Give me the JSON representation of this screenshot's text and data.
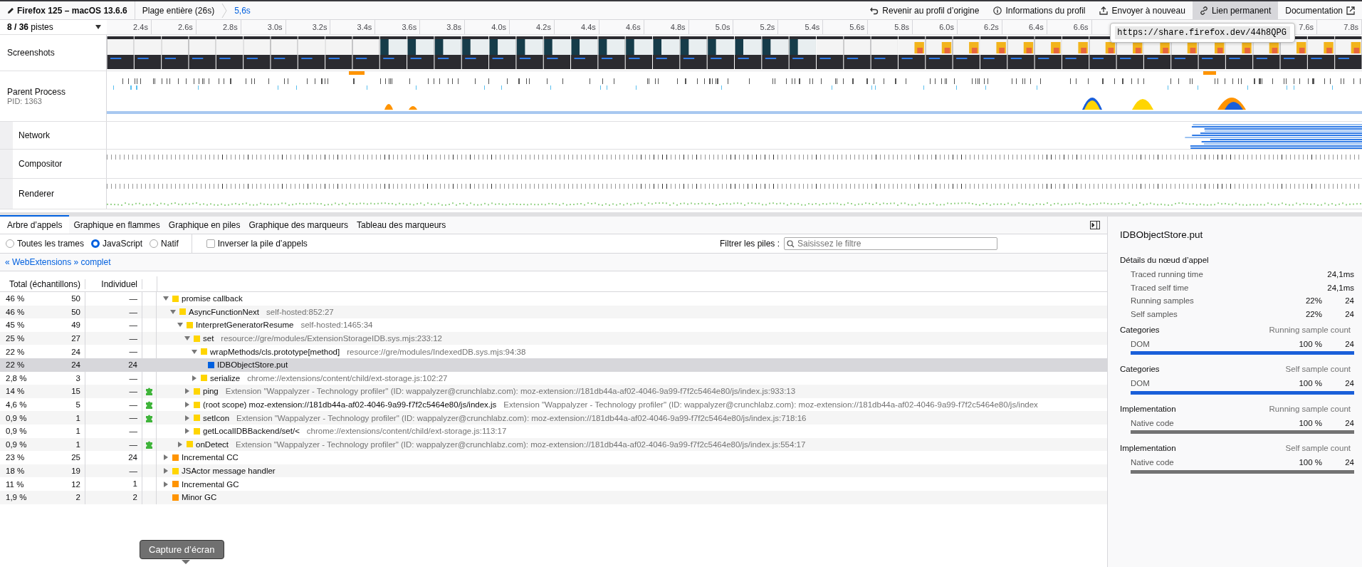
{
  "top_bar": {
    "breadcrumbs": [
      {
        "label": "Firefox 125 – macOS 13.6.6",
        "kind": "profile",
        "selected": false
      },
      {
        "label": "Plage entière (26s)",
        "kind": "range",
        "selected": false
      },
      {
        "label": "5,6s",
        "kind": "range",
        "selected": true
      }
    ],
    "buttons": [
      {
        "label": "Revenir au profil d’origine",
        "selected": false
      },
      {
        "label": "Informations du profil",
        "selected": false
      },
      {
        "label": "Envoyer à nouveau",
        "selected": false
      },
      {
        "label": "Lien permanent",
        "selected": true
      },
      {
        "label": "Documentation",
        "selected": false
      }
    ],
    "permalink": {
      "value": "https://share.firefox.dev/44h8QPG"
    }
  },
  "timeline": {
    "track_count": "**8 / 36** pistes",
    "ticks_left": [
      "2.4s",
      "2.6s",
      "2.8s",
      "3.0s",
      "3.2s",
      "3.4s",
      "3.6s",
      "3.8s",
      "4.0s",
      "4.2s",
      "4.4s",
      "4.6s",
      "4.8s",
      "5.0s",
      "5.2s",
      "5.4s",
      "5.6s",
      "5.8s",
      "6.0s",
      "6.2s",
      "6.4s",
      "6.6s"
    ],
    "ticks_right": [
      "7.6s",
      "7.8s"
    ],
    "tracks": [
      {
        "name": "Screenshots",
        "kind": "screenshots"
      },
      {
        "name": "Parent Process",
        "subtitle": "PID: 1363",
        "kind": "process",
        "children": [
          {
            "name": "Network",
            "kind": "network"
          },
          {
            "name": "Compositor",
            "kind": "markers"
          },
          {
            "name": "Renderer",
            "kind": "renderer"
          }
        ]
      }
    ]
  },
  "panel": {
    "tabs": [
      {
        "label": "Arbre d’appels",
        "selected": true
      },
      {
        "label": "Graphique en flammes",
        "selected": false
      },
      {
        "label": "Graphique en piles",
        "selected": false
      },
      {
        "label": "Graphique des marqueurs",
        "selected": false
      },
      {
        "label": "Tableau des marqueurs",
        "selected": false
      }
    ],
    "frame_options": [
      {
        "label": "Toutes les trames",
        "selected": false
      },
      {
        "label": "JavaScript",
        "selected": true
      },
      {
        "label": "Natif",
        "selected": false
      }
    ],
    "invert": {
      "label": "Inverser la pile d’appels",
      "checked": false
    },
    "filter": {
      "label": "Filtrer les piles :",
      "placeholder": "Saisissez le filtre"
    },
    "transform": "« WebExtensions » complet",
    "columns": [
      "Total (échantillons)",
      "Individuel"
    ],
    "rows": [
      {
        "total_pct": "46 %",
        "total": "50",
        "self": "—",
        "extension": false,
        "name": "promise callback",
        "color": "#ffd500",
        "expanded": true,
        "selected": false,
        "children": [
          {
            "total_pct": "46 %",
            "total": "50",
            "self": "—",
            "extension": false,
            "name": "AsyncFunctionNext",
            "location": "self-hosted:852:27",
            "color": "#ffd500",
            "expanded": true,
            "selected": false,
            "children": [
              {
                "total_pct": "45 %",
                "total": "49",
                "self": "—",
                "extension": false,
                "name": "InterpretGeneratorResume",
                "location": "self-hosted:1465:34",
                "color": "#ffd500",
                "expanded": true,
                "selected": false,
                "children": [
                  {
                    "total_pct": "25 %",
                    "total": "27",
                    "self": "—",
                    "extension": false,
                    "name": "set",
                    "location": "resource://gre/modules/ExtensionStorageIDB.sys.mjs:233:12",
                    "color": "#ffd500",
                    "expanded": true,
                    "selected": false,
                    "children": [
                      {
                        "total_pct": "22 %",
                        "total": "24",
                        "self": "—",
                        "extension": false,
                        "name": "wrapMethods/cls.prototype[method]",
                        "location": "resource://gre/modules/IndexedDB.sys.mjs:94:38",
                        "color": "#ffd500",
                        "expanded": true,
                        "selected": false,
                        "children": [
                          {
                            "total_pct": "22 %",
                            "total": "24",
                            "self": "24",
                            "extension": false,
                            "name": "IDBObjectStore.put",
                            "color": "#0060df",
                            "selected": true
                          }
                        ]
                      },
                      {
                        "total_pct": "2,8 %",
                        "total": "3",
                        "self": "—",
                        "extension": false,
                        "name": "serialize",
                        "location": "chrome://extensions/content/child/ext-storage.js:102:27",
                        "color": "#ffd500",
                        "expanded": false,
                        "selected": false
                      }
                    ]
                  },
                  {
                    "total_pct": "14 %",
                    "total": "15",
                    "self": "—",
                    "extension": true,
                    "name": "ping",
                    "location": "Extension \"Wappalyzer - Technology profiler\" (ID: wappalyzer@crunchlabz.com): moz-extension://181db44a-af02-4046-9a99-f7f2c5464e80/js/index.js:933:13",
                    "color": "#ffd500",
                    "expanded": false,
                    "selected": false
                  },
                  {
                    "total_pct": "4,6 %",
                    "total": "5",
                    "self": "—",
                    "extension": true,
                    "name": "(root scope) moz-extension://181db44a-af02-4046-9a99-f7f2c5464e80/js/index.js",
                    "location": "Extension \"Wappalyzer - Technology profiler\" (ID: wappalyzer@crunchlabz.com): moz-extension://181db44a-af02-4046-9a99-f7f2c5464e80/js/index",
                    "color": "#ffd500",
                    "expanded": false,
                    "selected": false
                  },
                  {
                    "total_pct": "0,9 %",
                    "total": "1",
                    "self": "—",
                    "extension": true,
                    "name": "setIcon",
                    "location": "Extension \"Wappalyzer - Technology profiler\" (ID: wappalyzer@crunchlabz.com): moz-extension://181db44a-af02-4046-9a99-f7f2c5464e80/js/index.js:718:16",
                    "color": "#ffd500",
                    "expanded": false,
                    "selected": false
                  },
                  {
                    "total_pct": "0,9 %",
                    "total": "1",
                    "self": "—",
                    "extension": false,
                    "name": "getLocalIDBBackend/set/<",
                    "location": "chrome://extensions/content/child/ext-storage.js:113:17",
                    "color": "#ffd500",
                    "expanded": false,
                    "selected": false
                  }
                ]
              },
              {
                "total_pct": "0,9 %",
                "total": "1",
                "self": "—",
                "extension": true,
                "name": "onDetect",
                "location": "Extension \"Wappalyzer - Technology profiler\" (ID: wappalyzer@crunchlabz.com): moz-extension://181db44a-af02-4046-9a99-f7f2c5464e80/js/index.js:554:17",
                "color": "#ffd500",
                "expanded": false,
                "selected": false
              }
            ]
          }
        ]
      },
      {
        "total_pct": "23 %",
        "total": "25",
        "self": "24",
        "extension": false,
        "name": "Incremental CC",
        "color": "#ff9400",
        "expanded": false,
        "selected": false
      },
      {
        "total_pct": "18 %",
        "total": "19",
        "self": "—",
        "extension": false,
        "name": "JSActor message handler",
        "color": "#ffd500",
        "expanded": false,
        "selected": false
      },
      {
        "total_pct": "11 %",
        "total": "12",
        "self": "1",
        "extension": false,
        "name": "Incremental GC",
        "color": "#ff9400",
        "expanded": false,
        "selected": false
      },
      {
        "total_pct": "1,9 %",
        "total": "2",
        "self": "2",
        "extension": false,
        "name": "Minor GC",
        "color": "#ff9400",
        "selected": false
      }
    ]
  },
  "sidebar": {
    "title": "IDBObjectStore.put",
    "details_title": "Détails du nœud d’appel",
    "details": [
      {
        "label": "Traced running time",
        "value": "24,1ms"
      },
      {
        "label": "Traced self time",
        "value": "24,1ms"
      },
      {
        "label": "Running samples",
        "percent": "22%",
        "value": "24"
      },
      {
        "label": "Self samples",
        "percent": "22%",
        "value": "24"
      }
    ],
    "sections": [
      {
        "title": "Categories",
        "header": "Running sample count",
        "items": [
          {
            "label": "DOM",
            "percent": "100 %",
            "count": "24",
            "level": 1,
            "color": "#1a5fd9"
          }
        ]
      },
      {
        "title": "Categories",
        "header": "Self sample count",
        "items": [
          {
            "label": "DOM",
            "percent": "100 %",
            "count": "24",
            "level": 1,
            "color": "#1a5fd9"
          }
        ]
      },
      {
        "title": "Implementation",
        "header": "Running sample count",
        "items": [
          {
            "label": "Native code",
            "percent": "100 %",
            "count": "24",
            "level": 1,
            "color": "#737373"
          }
        ]
      },
      {
        "title": "Implementation",
        "header": "Self sample count",
        "items": [
          {
            "label": "Native code",
            "percent": "100 %",
            "count": "24",
            "level": 1,
            "color": "#737373"
          }
        ]
      }
    ]
  },
  "hover_tooltip": "Capture d’écran"
}
